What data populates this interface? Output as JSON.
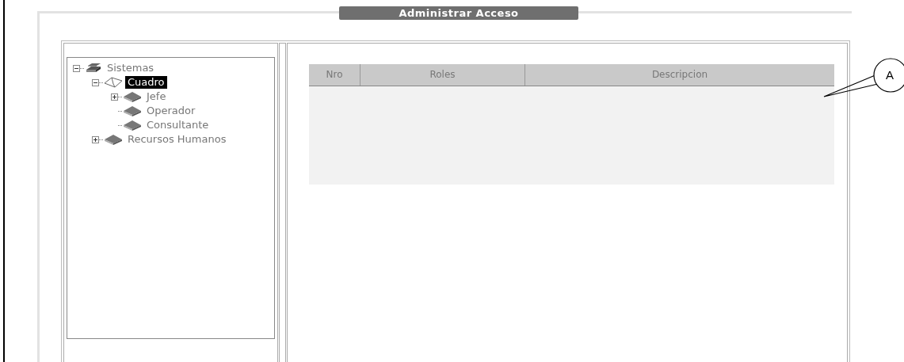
{
  "panel": {
    "title": "Administrar Acceso"
  },
  "tree": [
    {
      "label": "Sistemas",
      "kind": "expanded",
      "selected": false,
      "children": [
        {
          "label": "Cuadro",
          "kind": "expanded",
          "selected": true,
          "children": [
            {
              "label": "Jefe",
              "kind": "collapsed",
              "selected": false
            },
            {
              "label": "Operador",
              "kind": "leaf",
              "selected": false
            },
            {
              "label": "Consultante",
              "kind": "leaf",
              "selected": false
            }
          ]
        },
        {
          "label": "Recursos Humanos",
          "kind": "collapsed",
          "selected": false
        }
      ]
    }
  ],
  "table": {
    "columns": [
      "Nro",
      "Roles",
      "Descripcion"
    ]
  },
  "callout": {
    "label": "A"
  }
}
